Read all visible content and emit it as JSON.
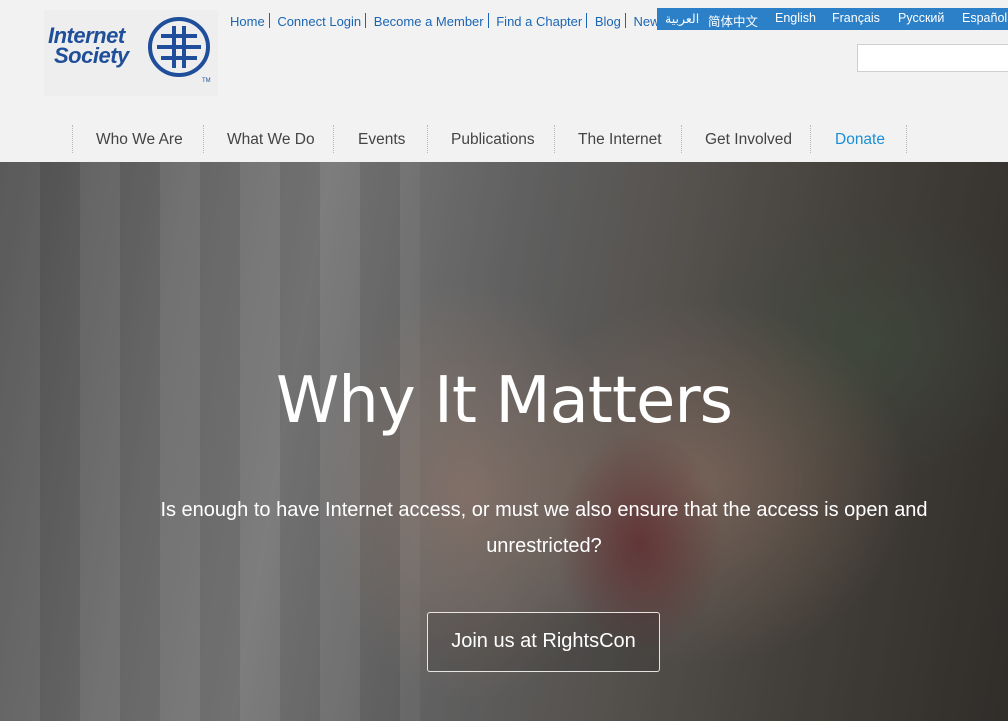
{
  "logo": {
    "line1": "Internet",
    "line2": "Society",
    "tm": "TM"
  },
  "toplinks": [
    "Home",
    "Connect Login",
    "Become a Member",
    "Find a Chapter",
    "Blog",
    "News"
  ],
  "languages": [
    "العربية",
    "简体中文",
    "English",
    "Français",
    "Русский",
    "Español"
  ],
  "search": {
    "placeholder": ""
  },
  "nav": [
    "Who We Are",
    "What We Do",
    "Events",
    "Publications",
    "The Internet",
    "Get Involved",
    "Donate"
  ],
  "hero": {
    "title": "Why It Matters",
    "subtitle": "Is enough to have Internet access, or must we also ensure that the access is open and unrestricted?",
    "cta": "Join us at RightsCon"
  },
  "colors": {
    "brand": "#1f4e9a",
    "link": "#1a66b3",
    "langbar": "#2c80c8",
    "donate": "#1a8fd6"
  }
}
